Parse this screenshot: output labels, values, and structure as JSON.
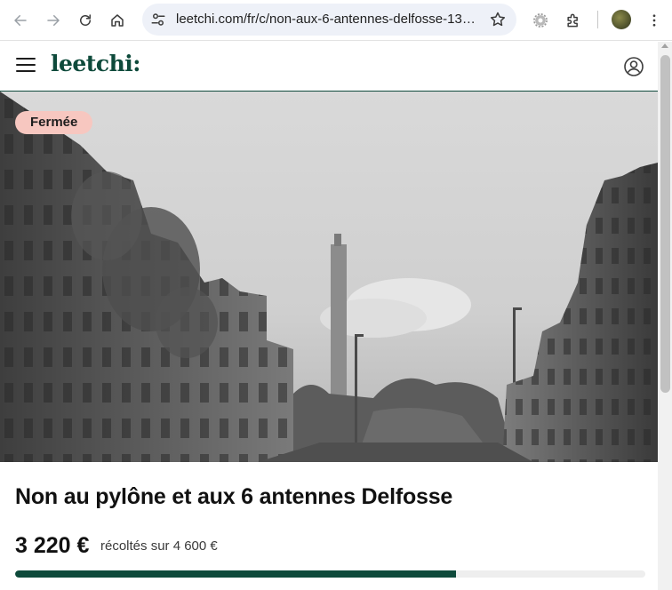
{
  "browser": {
    "url": "leetchi.com/fr/c/non-aux-6-antennes-delfosse-1377...",
    "icons": [
      "back-icon",
      "forward-icon",
      "reload-icon",
      "home-icon",
      "tune-icon",
      "star-icon",
      "extension-gear-icon",
      "puzzle-icon",
      "profile-avatar",
      "kebab-menu-icon"
    ]
  },
  "site": {
    "logo": "leetchi:",
    "brand_color": "#0e4a3b"
  },
  "hero": {
    "status_badge": "Fermée",
    "badge_color": "#f7c7c0"
  },
  "pot": {
    "title": "Non au pylône et aux 6 antennes Delfosse",
    "amount": "3 220 €",
    "collected_text": "récoltés sur 4 600 €",
    "progress_fraction": 0.7
  }
}
